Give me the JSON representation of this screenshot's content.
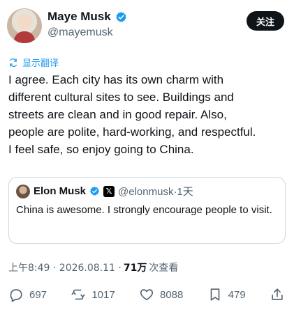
{
  "author": {
    "display_name": "Maye Musk",
    "handle": "@mayemusk"
  },
  "follow_button_label": "关注",
  "translate_label": "显示翻译",
  "tweet_text": "I agree. Each city has its own charm with\ndifferent cultural sites to see. Buildings and\nstreets are clean and in good repair. Also,\npeople are polite, hard-working, and respectful.\nI feel safe, so enjoy going to China.",
  "quote": {
    "display_name": "Elon Musk",
    "handle_time": "@elonmusk·1天",
    "text": "China is awesome. I strongly encourage people to visit."
  },
  "meta": {
    "timestamp": "上午8:49 · 2026.08.11 · ",
    "views_count": "71万",
    "views_label": " 次查看"
  },
  "actions": {
    "replies": "697",
    "reposts": "1017",
    "likes": "8088",
    "bookmarks": "479"
  },
  "colors": {
    "accent": "#1d9bf0",
    "text": "#0f1419",
    "muted": "#536471"
  },
  "icons": [
    "verified-icon",
    "translate-icon",
    "x-logo-icon",
    "reply-icon",
    "repost-icon",
    "like-icon",
    "bookmark-icon",
    "share-icon"
  ]
}
